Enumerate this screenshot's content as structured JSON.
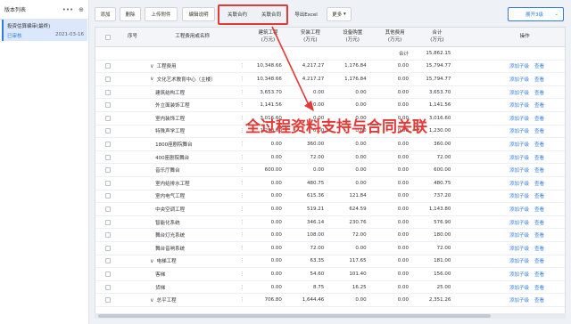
{
  "left_panel": {
    "title": "版本列表",
    "more_icon": "•••",
    "add_icon": "⊕",
    "version": {
      "name": "投资估算编审(最终)",
      "status": "已审核",
      "date": "2021-03-16"
    }
  },
  "toolbar": {
    "add": "添加",
    "delete": "删除",
    "upload": "上传附件",
    "edit_desc": "编辑说明",
    "link_contract1": "关联合约",
    "link_contract2": "关联合同",
    "export_excel": "导出Excel",
    "more": "更多",
    "expand": "展开3级"
  },
  "table": {
    "headers": {
      "seq": "序号",
      "name": "工程费用或名称",
      "build_cost": [
        "建筑工程",
        "(万元)"
      ],
      "install_cost": [
        "安装工程",
        "(万元)"
      ],
      "equip_cost": [
        "设备购置",
        "(万元)"
      ],
      "other_cost": [
        "其他费用",
        "(万元)"
      ],
      "total": [
        "合计",
        "(万元)"
      ],
      "op": "操作"
    },
    "summary": {
      "label": "合计",
      "total": "15,862.15"
    },
    "add_child": "添加子级",
    "view": "查看",
    "rows": [
      {
        "name": "工程费用",
        "caret": "∨",
        "level": 0,
        "b": "10,348.66",
        "i": "4,217.27",
        "e": "1,176.84",
        "o": "0.00",
        "t": "15,794.77"
      },
      {
        "name": "文化艺术教育中心（主楼）",
        "caret": "∨",
        "level": 0,
        "b": "10,348.66",
        "i": "4,217.27",
        "e": "1,176.84",
        "o": "0.00",
        "t": "15,794.77"
      },
      {
        "name": "建筑结构工程",
        "caret": "",
        "level": 1,
        "b": "3,653.70",
        "i": "0.00",
        "e": "0.00",
        "o": "0.00",
        "t": "3,653.70"
      },
      {
        "name": "外立面装饰工程",
        "caret": "",
        "level": 1,
        "b": "1,141.56",
        "i": "0.00",
        "e": "0.00",
        "o": "0.00",
        "t": "1,141.56"
      },
      {
        "name": "室内装饰工程",
        "caret": "",
        "level": 1,
        "b": "3,016.60",
        "i": "0.00",
        "e": "0.00",
        "o": "0.00",
        "t": "3,016.60"
      },
      {
        "name": "特殊声学工程",
        "caret": "",
        "level": 1,
        "b": "1,230.00",
        "i": "0.00",
        "e": "0.00",
        "o": "0.00",
        "t": "1,230.00"
      },
      {
        "name": "1800座剧院舞台",
        "caret": "",
        "level": 1,
        "b": "0.00",
        "i": "360.00",
        "e": "0.00",
        "o": "0.00",
        "t": "360.00"
      },
      {
        "name": "400座剧院舞台",
        "caret": "",
        "level": 1,
        "b": "0.00",
        "i": "72.00",
        "e": "0.00",
        "o": "0.00",
        "t": "72.00"
      },
      {
        "name": "音乐厅舞台",
        "caret": "",
        "level": 1,
        "b": "600.00",
        "i": "0.00",
        "e": "0.00",
        "o": "0.00",
        "t": "600.00"
      },
      {
        "name": "室内给排水工程",
        "caret": "",
        "level": 1,
        "b": "0.00",
        "i": "480.75",
        "e": "0.00",
        "o": "0.00",
        "t": "480.75"
      },
      {
        "name": "室内电气工程",
        "caret": "",
        "level": 1,
        "b": "0.00",
        "i": "615.36",
        "e": "121.84",
        "o": "0.00",
        "t": "737.20"
      },
      {
        "name": "中央空调工程",
        "caret": "",
        "level": 1,
        "b": "0.00",
        "i": "519.21",
        "e": "624.59",
        "o": "0.00",
        "t": "1,143.80"
      },
      {
        "name": "智能化系统",
        "caret": "",
        "level": 1,
        "b": "0.00",
        "i": "346.14",
        "e": "230.76",
        "o": "0.00",
        "t": "576.90"
      },
      {
        "name": "舞台灯光系统",
        "caret": "",
        "level": 1,
        "b": "0.00",
        "i": "108.00",
        "e": "72.00",
        "o": "0.00",
        "t": "180.00"
      },
      {
        "name": "舞台音响系统",
        "caret": "",
        "level": 1,
        "b": "0.00",
        "i": "72.00",
        "e": "0.00",
        "o": "0.00",
        "t": "72.00"
      },
      {
        "name": "电梯工程",
        "caret": "∨",
        "level": 0,
        "b": "0.00",
        "i": "63.35",
        "e": "117.65",
        "o": "0.00",
        "t": "181.00"
      },
      {
        "name": "客梯",
        "caret": "",
        "level": 1,
        "b": "0.00",
        "i": "54.60",
        "e": "101.40",
        "o": "0.00",
        "t": "156.00"
      },
      {
        "name": "货梯",
        "caret": "",
        "level": 1,
        "b": "0.00",
        "i": "8.75",
        "e": "16.25",
        "o": "0.00",
        "t": "25.00"
      },
      {
        "name": "总平工程",
        "caret": "∨",
        "level": 0,
        "b": "706.80",
        "i": "1,644.46",
        "e": "0.00",
        "o": "0.00",
        "t": "2,351.26"
      }
    ]
  },
  "overlay": {
    "text": "全过程资料支持与合同关联"
  },
  "colors": {
    "accent": "#2f7de1",
    "highlight": "#e53935"
  }
}
